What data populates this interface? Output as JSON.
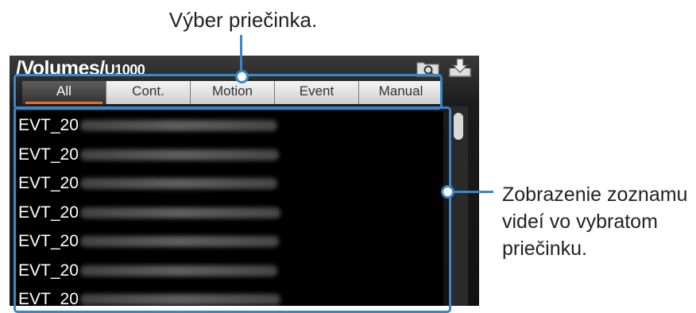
{
  "annotations": {
    "folder_select": "Výber priečinka.",
    "list_desc_lines": [
      "Zobrazenie zoznamu",
      "videí vo vybratom",
      "priečinku."
    ]
  },
  "header": {
    "path_main": "/Volumes/",
    "path_small": "U1000",
    "icons": [
      "search-folder-icon",
      "download-icon"
    ]
  },
  "tabs": [
    {
      "label": "All",
      "active": true
    },
    {
      "label": "Cont.",
      "active": false
    },
    {
      "label": "Motion",
      "active": false
    },
    {
      "label": "Event",
      "active": false
    },
    {
      "label": "Manual",
      "active": false
    }
  ],
  "files": [
    {
      "prefix": "EVT_20",
      "blurred": true
    },
    {
      "prefix": "EVT_20",
      "blurred": true
    },
    {
      "prefix": "EVT_20",
      "blurred": true
    },
    {
      "prefix": "EVT_20",
      "blurred": true
    },
    {
      "prefix": "EVT_20",
      "blurred": true
    },
    {
      "prefix": "EVT_20",
      "blurred": true
    },
    {
      "prefix": "EVT_20",
      "blurred": true
    }
  ],
  "colors": {
    "accent": "#e8702a",
    "highlight": "#3a86c8"
  }
}
